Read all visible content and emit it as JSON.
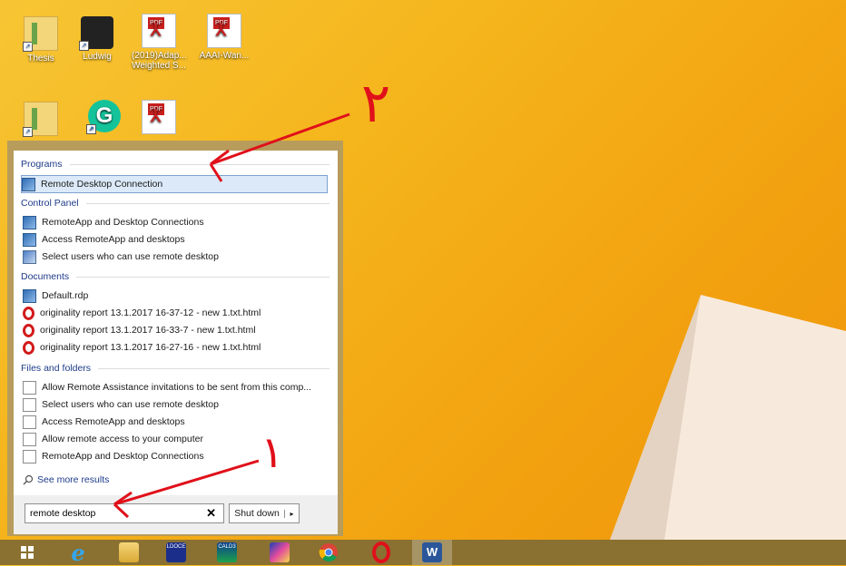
{
  "desktop": {
    "icons": [
      {
        "label": "Thesis"
      },
      {
        "label": "Ludwig"
      },
      {
        "label": "(2019)Adap... Weighted S..."
      },
      {
        "label": "AAAI-Wan..."
      }
    ],
    "pdf_tag": "PDF",
    "annotations": {
      "step_one": "۱",
      "step_two": "۲"
    }
  },
  "start_menu": {
    "categories": {
      "programs": "Programs",
      "control_panel": "Control Panel",
      "documents": "Documents",
      "files_and_folders": "Files and folders"
    },
    "programs": [
      {
        "label": "Remote Desktop Connection",
        "selected": true
      }
    ],
    "control_panel": [
      {
        "label": "RemoteApp and Desktop Connections"
      },
      {
        "label": "Access RemoteApp and desktops"
      },
      {
        "label": "Select users who can use remote desktop"
      }
    ],
    "documents": [
      {
        "label": "Default.rdp"
      },
      {
        "label": "originality report 13.1.2017 16-37-12 - new 1.txt.html"
      },
      {
        "label": "originality report 13.1.2017 16-33-7 - new 1.txt.html"
      },
      {
        "label": "originality report 13.1.2017 16-27-16 - new 1.txt.html"
      }
    ],
    "files": [
      {
        "label": "Allow Remote Assistance invitations to be sent from this comp..."
      },
      {
        "label": "Select users who can use remote desktop"
      },
      {
        "label": "Access RemoteApp and desktops"
      },
      {
        "label": "Allow remote access to your computer"
      },
      {
        "label": "RemoteApp and Desktop Connections"
      }
    ],
    "see_more": "See more results",
    "search": {
      "value": "remote desktop",
      "clear": "✕"
    },
    "shutdown": {
      "label": "Shut down",
      "arrow": "▸"
    }
  },
  "taskbar": {
    "items": [
      {
        "name": "start-button",
        "icon": "windows-icon"
      },
      {
        "name": "internet-explorer",
        "icon": "ie-icon"
      },
      {
        "name": "file-explorer",
        "icon": "folder-icon"
      },
      {
        "name": "ldoce-dictionary",
        "icon": "ldoce-icon",
        "text": "LDOCE"
      },
      {
        "name": "cald-dictionary",
        "icon": "cald-icon",
        "text": "CALD3"
      },
      {
        "name": "app-butterfly",
        "icon": "butterfly-icon"
      },
      {
        "name": "chrome",
        "icon": "chrome-icon"
      },
      {
        "name": "opera",
        "icon": "opera-icon"
      },
      {
        "name": "word",
        "icon": "word-icon",
        "text": "W",
        "active": true
      }
    ]
  },
  "colors": {
    "annotation_red": "#e0101a",
    "menu_frame": "#b79c5b",
    "taskbar": "#8a7131",
    "category_text": "#1e3b8a"
  }
}
